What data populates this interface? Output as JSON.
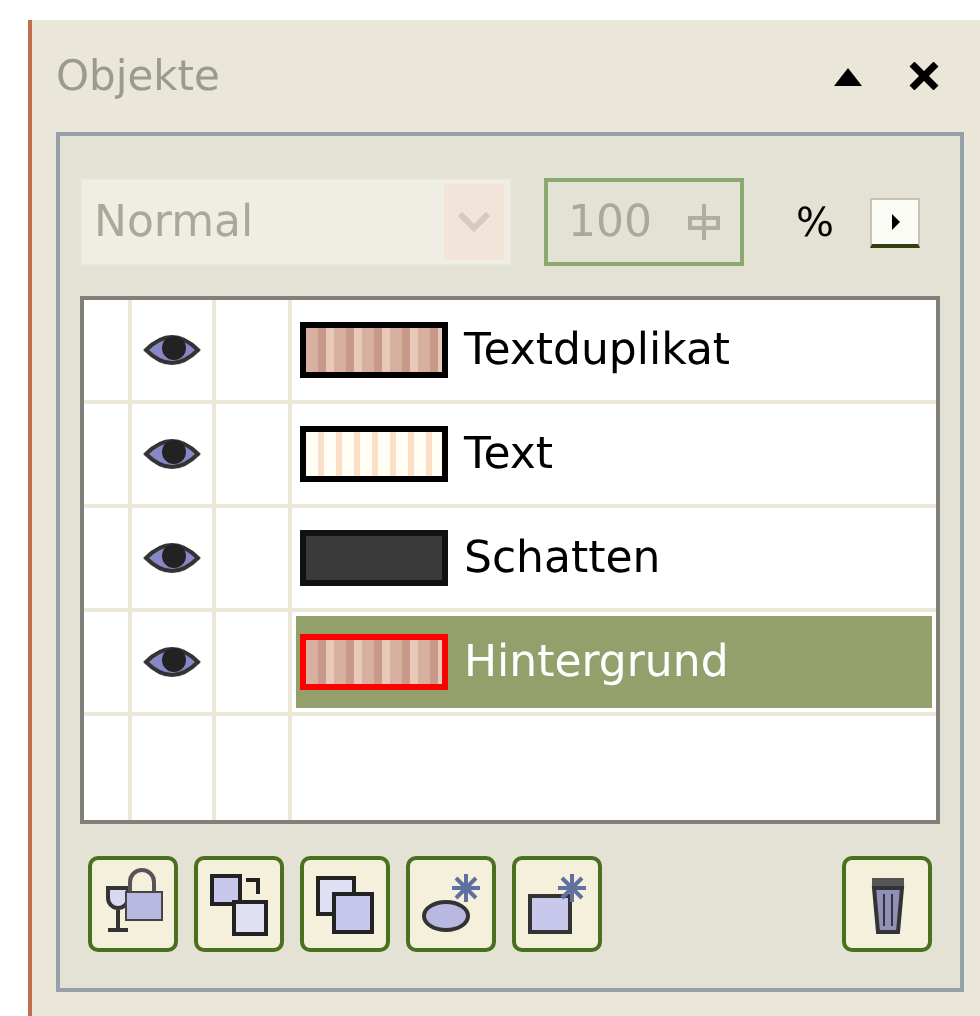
{
  "panel": {
    "title": "Objekte"
  },
  "blend_mode": {
    "value": "Normal",
    "disabled": true
  },
  "opacity": {
    "value": "100",
    "disabled": true,
    "unit": "%"
  },
  "layers": [
    {
      "name": "Textduplikat",
      "visible": true,
      "selected": false,
      "kind": "textured"
    },
    {
      "name": "Text",
      "visible": true,
      "selected": false,
      "kind": "light"
    },
    {
      "name": "Schatten",
      "visible": true,
      "selected": false,
      "kind": "dark"
    },
    {
      "name": "Hintergrund",
      "visible": true,
      "selected": true,
      "kind": "textured"
    }
  ]
}
